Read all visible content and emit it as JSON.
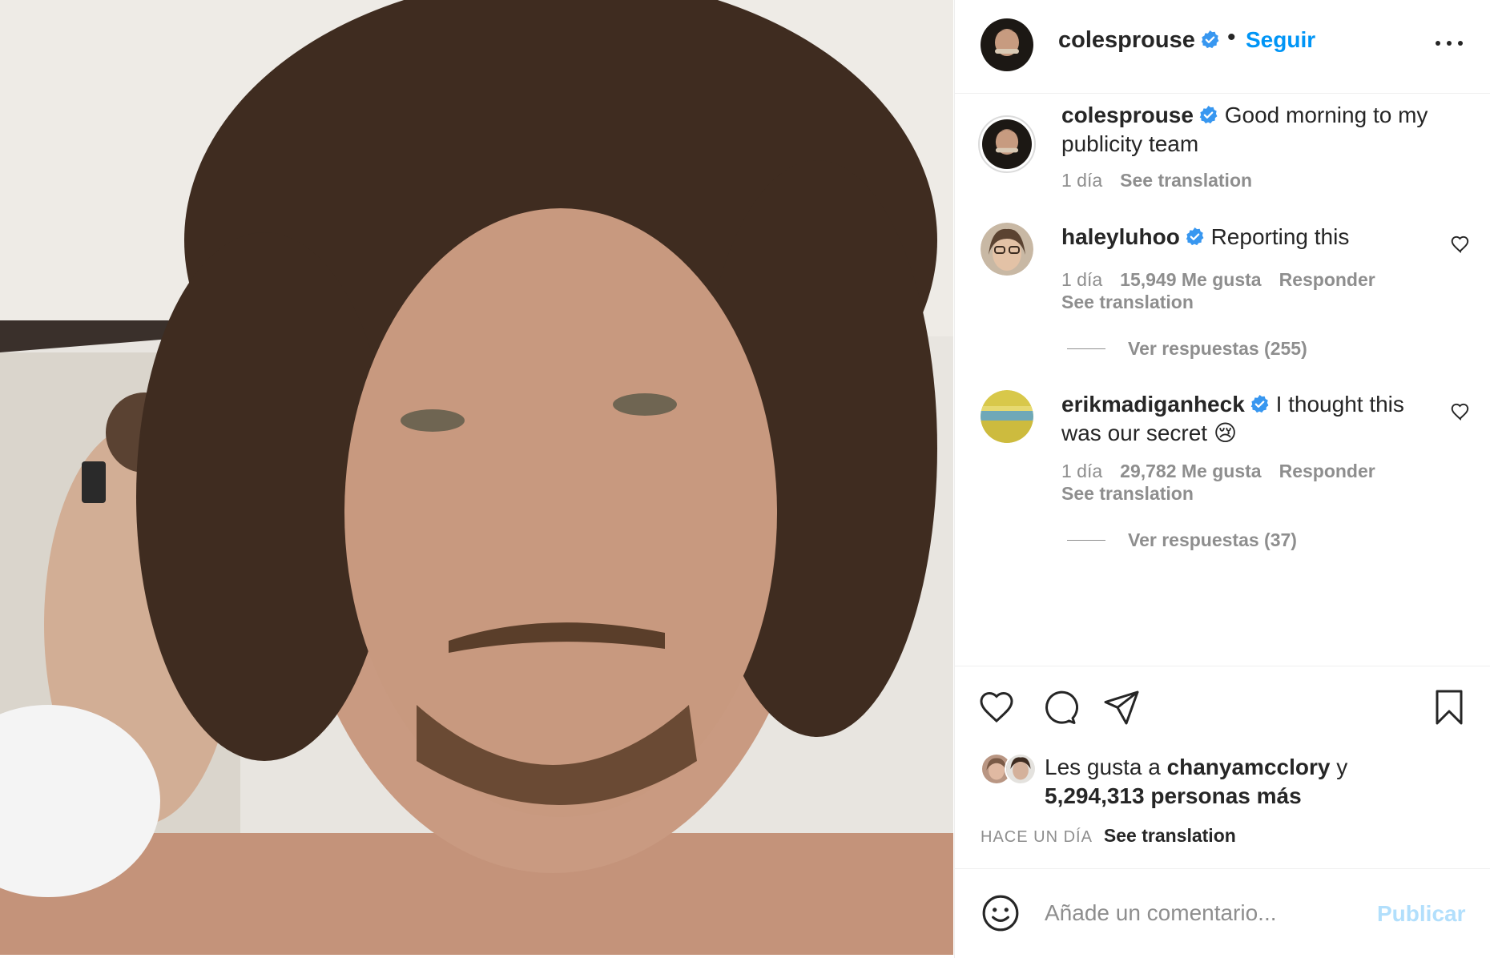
{
  "post": {
    "image_alt": "Post photo",
    "author": {
      "username": "colesprouse",
      "follow_label": "Seguir",
      "separator": "•"
    },
    "caption": {
      "username": "colesprouse",
      "text": "Good morning to my publicity team",
      "time": "1 día",
      "translate": "See translation"
    }
  },
  "comments": [
    {
      "username": "haleyluhoo",
      "text": "Reporting this",
      "time": "1 día",
      "likes": "15,949 Me gusta",
      "reply": "Responder",
      "translate": "See translation",
      "view_replies": "Ver respuestas (255)"
    },
    {
      "username": "erikmadiganheck",
      "text": "I thought this was our secret 😢",
      "time": "1 día",
      "likes": "29,782 Me gusta",
      "reply": "Responder",
      "translate": "See translation",
      "view_replies": "Ver respuestas (37)"
    }
  ],
  "actions": {
    "icons": [
      "heart-icon",
      "comment-icon",
      "share-icon",
      "bookmark-icon"
    ]
  },
  "likes": {
    "prefix": "Les gusta a ",
    "user": "chanyamcclory",
    "connector": " y",
    "others": "5,294,313 personas más"
  },
  "timestamp": {
    "label": "HACE UN DÍA",
    "translate": "See translation"
  },
  "composer": {
    "placeholder": "Añade un comentario...",
    "publish_label": "Publicar"
  },
  "colors": {
    "accent": "#0095f6",
    "publish_disabled": "#b2dffc",
    "muted": "#8e8e8e",
    "text": "#262626"
  }
}
